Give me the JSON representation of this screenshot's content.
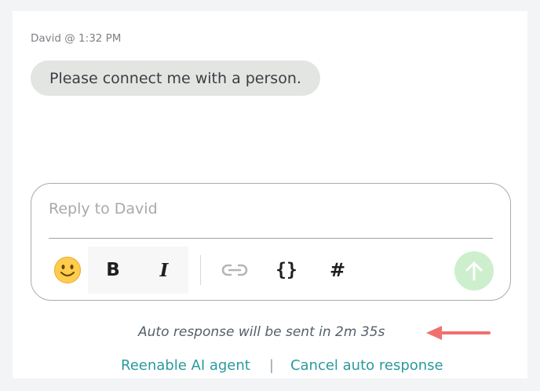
{
  "message": {
    "sender_meta": "David @ 1:32 PM",
    "text": "Please connect me with a person."
  },
  "composer": {
    "placeholder": "Reply to David",
    "toolbar": {
      "emoji": "emoji-icon",
      "bold": "B",
      "italic": "I",
      "link": "link-icon",
      "code": "{}",
      "hashtag": "#",
      "send": "send-arrow-up-icon"
    }
  },
  "auto_response": {
    "note": "Auto response will be sent in 2m 35s",
    "arrow_color": "#f07070"
  },
  "actions": {
    "reenable_label": "Reenable AI agent",
    "separator": "|",
    "cancel_label": "Cancel auto response"
  },
  "colors": {
    "link": "#2a9a9e",
    "send_button": "#cdefcd",
    "bubble": "#e3e5e3"
  }
}
